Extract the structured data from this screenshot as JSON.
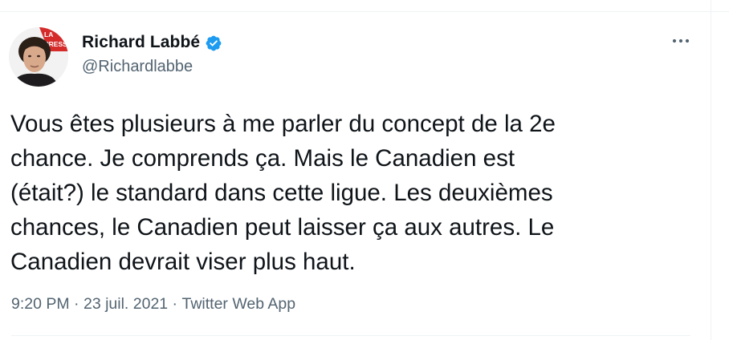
{
  "tweet": {
    "author": {
      "display_name": "Richard Labbé",
      "handle": "@Richardlabbe",
      "avatar_badge": "LA PRESSE",
      "verified": true
    },
    "text": "Vous êtes plusieurs à me parler du concept de la 2e\nchance. Je comprends ça. Mais le Canadien est\n(était?) le standard dans cette ligue. Les deuxièmes\nchances, le Canadien peut laisser ça aux autres. Le\nCanadien devrait viser plus haut.",
    "meta": {
      "time": "9:20 PM",
      "separator": " · ",
      "date": "23 juil. 2021",
      "source": "Twitter Web App"
    },
    "icons": {
      "verified": "verified-badge-icon",
      "more": "more-options-icon"
    },
    "colors": {
      "verified_blue": "#1d9bf0",
      "text_primary": "#0f1419",
      "text_secondary": "#536471",
      "avatar_badge_red": "#d52b2b"
    }
  }
}
